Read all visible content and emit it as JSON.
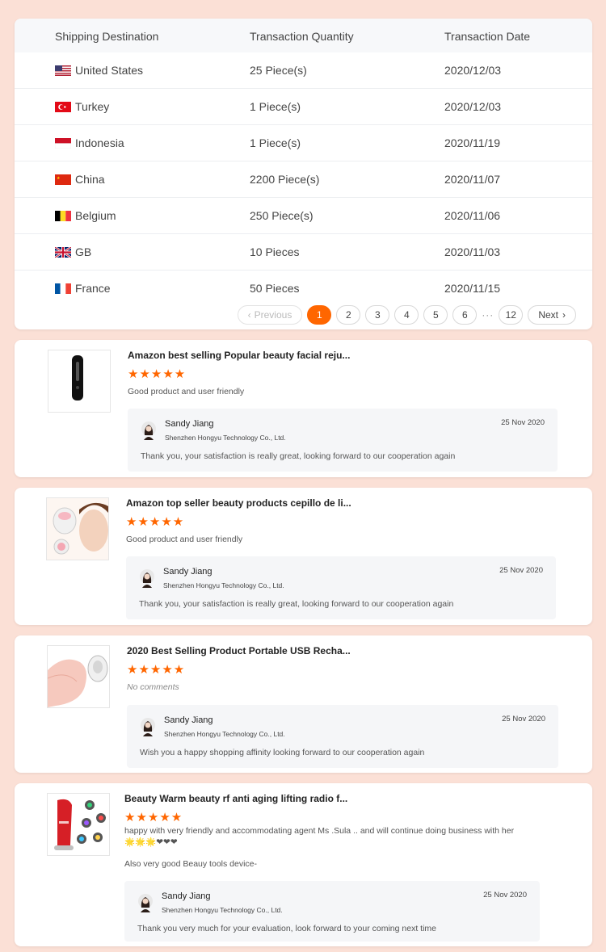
{
  "transactions": {
    "headers": {
      "destination": "Shipping Destination",
      "quantity": "Transaction Quantity",
      "date": "Transaction Date"
    },
    "rows": [
      {
        "country": "United States",
        "flag": "us-flag-icon",
        "quantity": "25 Piece(s)",
        "date": "2020/12/03"
      },
      {
        "country": "Turkey",
        "flag": "turkey-flag-icon",
        "quantity": "1 Piece(s)",
        "date": "2020/12/03"
      },
      {
        "country": "Indonesia",
        "flag": "indonesia-flag-icon",
        "quantity": "1 Piece(s)",
        "date": "2020/11/19"
      },
      {
        "country": "China",
        "flag": "china-flag-icon",
        "quantity": "2200 Piece(s)",
        "date": "2020/11/07"
      },
      {
        "country": "Belgium",
        "flag": "belgium-flag-icon",
        "quantity": "250 Piece(s)",
        "date": "2020/11/06"
      },
      {
        "country": "GB",
        "flag": "gb-flag-icon",
        "quantity": "10 Pieces",
        "date": "2020/11/03"
      },
      {
        "country": "France",
        "flag": "france-flag-icon",
        "quantity": "50 Pieces",
        "date": "2020/11/15"
      }
    ],
    "pagination": {
      "previous": "Previous",
      "next": "Next",
      "pages": [
        "1",
        "2",
        "3",
        "4",
        "5",
        "6"
      ],
      "ellipsis": "···",
      "last": "12",
      "current": "1",
      "accent": "#ff6600"
    }
  },
  "reviews": [
    {
      "title": "Amazon best selling Popular beauty facial reju...",
      "stars": "★★★★★",
      "comment": "Good product and user friendly",
      "reply": {
        "name": "Sandy Jiang",
        "company": "Shenzhen Hongyu Technology Co., Ltd.",
        "date": "25 Nov 2020",
        "text": "Thank you, your satisfaction is really great, looking forward to our cooperation again"
      }
    },
    {
      "title": "Amazon top seller beauty products cepillo de li...",
      "stars": "★★★★★",
      "comment": "Good product and user friendly",
      "reply": {
        "name": "Sandy Jiang",
        "company": "Shenzhen Hongyu Technology Co., Ltd.",
        "date": "25 Nov 2020",
        "text": "Thank you, your satisfaction is really great, looking forward to our cooperation again"
      }
    },
    {
      "title": "2020 Best Selling Product Portable USB Recha...",
      "stars": "★★★★★",
      "comment": "No comments",
      "reply": {
        "name": "Sandy Jiang",
        "company": "Shenzhen Hongyu Technology Co., Ltd.",
        "date": "25 Nov 2020",
        "text": "Wish you a happy shopping affinity looking forward to our cooperation again"
      }
    },
    {
      "title": "Beauty Warm beauty rf anti aging lifting radio f...",
      "stars": "★★★★★",
      "comment": "happy with very friendly and accommodating agent Ms .Sula .. and will continue doing business with her 🌟🌟🌟❤❤❤",
      "comment2": "Also very good Beauy tools device-",
      "reply": {
        "name": "Sandy Jiang",
        "company": "Shenzhen Hongyu Technology Co., Ltd.",
        "date": "25 Nov 2020",
        "text": "Thank you very much for your evaluation, look forward to your coming next time"
      }
    }
  ]
}
